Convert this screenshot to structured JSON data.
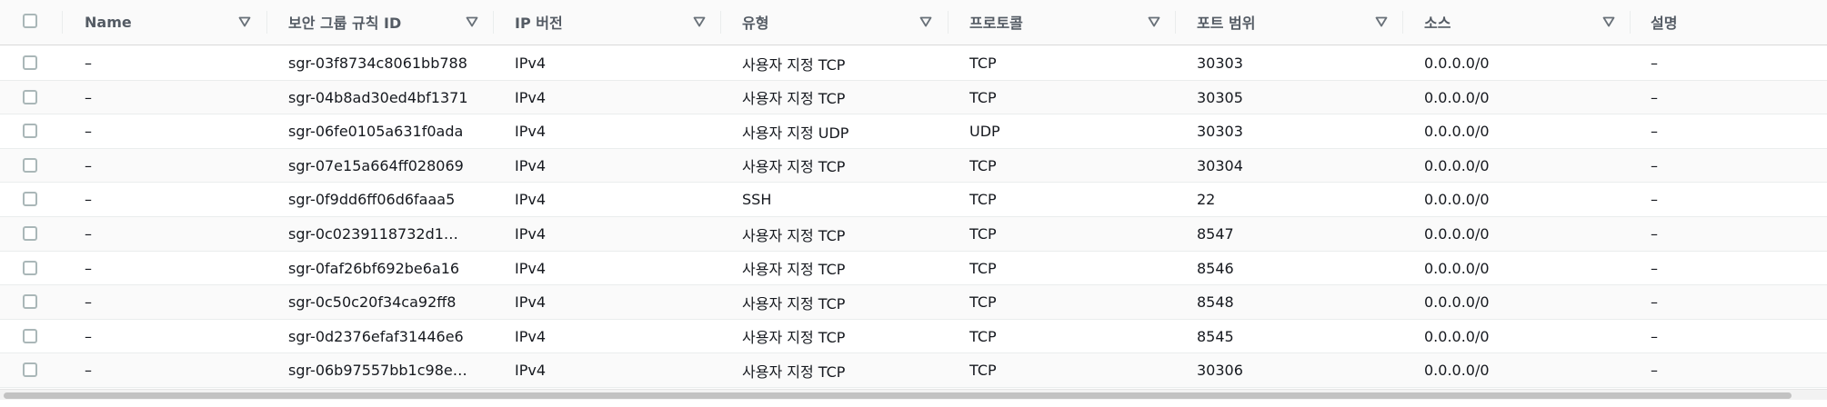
{
  "table": {
    "columns": [
      {
        "label": "Name",
        "sortable": true
      },
      {
        "label": "보안 그룹 규칙 ID",
        "sortable": true
      },
      {
        "label": "IP 버전",
        "sortable": true
      },
      {
        "label": "유형",
        "sortable": true
      },
      {
        "label": "프로토콜",
        "sortable": true
      },
      {
        "label": "포트 범위",
        "sortable": true
      },
      {
        "label": "소스",
        "sortable": true
      },
      {
        "label": "설명",
        "sortable": false
      }
    ],
    "rows": [
      {
        "name": "–",
        "rule_id": "sgr-03f8734c8061bb788",
        "ip_version": "IPv4",
        "type": "사용자 지정 TCP",
        "protocol": "TCP",
        "port_range": "30303",
        "source": "0.0.0.0/0",
        "description": "–"
      },
      {
        "name": "–",
        "rule_id": "sgr-04b8ad30ed4bf1371",
        "ip_version": "IPv4",
        "type": "사용자 지정 TCP",
        "protocol": "TCP",
        "port_range": "30305",
        "source": "0.0.0.0/0",
        "description": "–"
      },
      {
        "name": "–",
        "rule_id": "sgr-06fe0105a631f0ada",
        "ip_version": "IPv4",
        "type": "사용자 지정 UDP",
        "protocol": "UDP",
        "port_range": "30303",
        "source": "0.0.0.0/0",
        "description": "–"
      },
      {
        "name": "–",
        "rule_id": "sgr-07e15a664ff028069",
        "ip_version": "IPv4",
        "type": "사용자 지정 TCP",
        "protocol": "TCP",
        "port_range": "30304",
        "source": "0.0.0.0/0",
        "description": "–"
      },
      {
        "name": "–",
        "rule_id": "sgr-0f9dd6ff06d6faaa5",
        "ip_version": "IPv4",
        "type": "SSH",
        "protocol": "TCP",
        "port_range": "22",
        "source": "0.0.0.0/0",
        "description": "–"
      },
      {
        "name": "–",
        "rule_id": "sgr-0c0239118732d1…",
        "ip_version": "IPv4",
        "type": "사용자 지정 TCP",
        "protocol": "TCP",
        "port_range": "8547",
        "source": "0.0.0.0/0",
        "description": "–"
      },
      {
        "name": "–",
        "rule_id": "sgr-0faf26bf692be6a16",
        "ip_version": "IPv4",
        "type": "사용자 지정 TCP",
        "protocol": "TCP",
        "port_range": "8546",
        "source": "0.0.0.0/0",
        "description": "–"
      },
      {
        "name": "–",
        "rule_id": "sgr-0c50c20f34ca92ff8",
        "ip_version": "IPv4",
        "type": "사용자 지정 TCP",
        "protocol": "TCP",
        "port_range": "8548",
        "source": "0.0.0.0/0",
        "description": "–"
      },
      {
        "name": "–",
        "rule_id": "sgr-0d2376efaf31446e6",
        "ip_version": "IPv4",
        "type": "사용자 지정 TCP",
        "protocol": "TCP",
        "port_range": "8545",
        "source": "0.0.0.0/0",
        "description": "–"
      },
      {
        "name": "–",
        "rule_id": "sgr-06b97557bb1c98e…",
        "ip_version": "IPv4",
        "type": "사용자 지정 TCP",
        "protocol": "TCP",
        "port_range": "30306",
        "source": "0.0.0.0/0",
        "description": "–"
      }
    ]
  },
  "colors": {
    "header_bg": "#fafafa",
    "header_text": "#545b64",
    "row_text": "#16191f",
    "row_alt_bg": "#fafafa",
    "border": "#eaeded",
    "checkbox_border": "#aab7b8",
    "scrollbar_thumb": "#c2c2c2"
  },
  "icons": {
    "sort": "caret-down-outline-icon",
    "checkbox": "checkbox-icon"
  }
}
